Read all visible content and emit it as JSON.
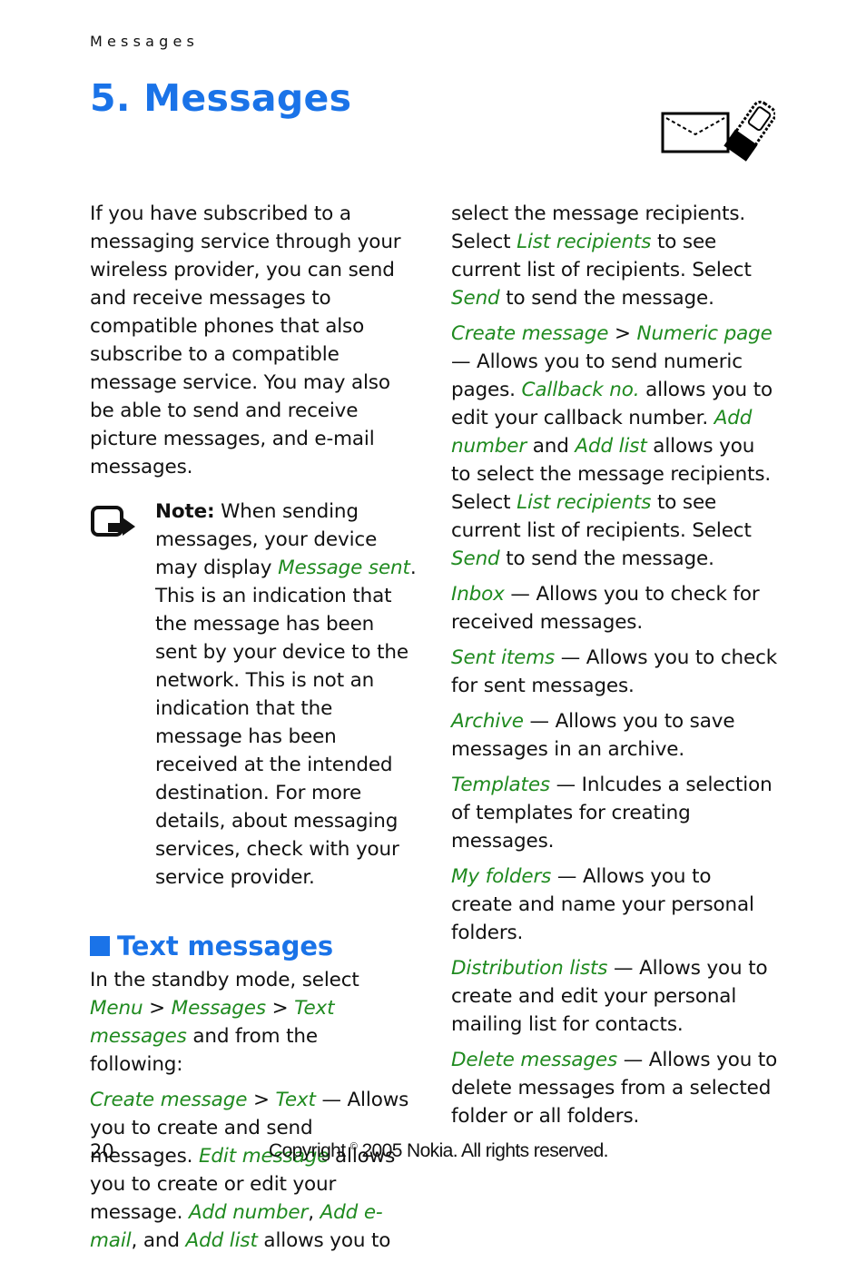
{
  "header": {
    "running_title": "Messages"
  },
  "chapter": {
    "title": "5. Messages",
    "icon": "envelope-phone-icon"
  },
  "intro": "If you have subscribed to a messaging service through your wireless provider, you can send and receive messages to compatible phones that also subscribe to a compatible message service. You may also be able to send and receive picture messages, and e-mail messages.",
  "note": {
    "label": "Note:",
    "text_before": " When sending messages, your device may display ",
    "highlight": "Message sent",
    "text_after": ". This is an indication that the message has been sent by your device to the network. This is not an indication that the message has been received at the intended destination. For more details, about messaging services, check with your service provider."
  },
  "section": {
    "title": "Text messages",
    "intro": {
      "t1": "In the standby mode, select ",
      "menu": "Menu",
      "sep1": " > ",
      "messages": "Messages",
      "sep2": " > ",
      "text_messages": "Text messages",
      "t2": " and from the following:"
    },
    "create_text": {
      "create": "Create message",
      "sep": " > ",
      "text": "Text",
      "t1": " — Allows you to create and send messages. ",
      "edit": "Edit message",
      "t2": " allows you to create or edit your message. ",
      "add_number": "Add number",
      "comma": ", ",
      "add_email": "Add e-mail",
      "t3": ", and ",
      "add_list": "Add list",
      "t4": " allows you to select the message recipients. Select ",
      "list_recipients": "List recipients",
      "t5": " to see current list of recipients. Select ",
      "send": "Send",
      "t6": " to send the message."
    },
    "create_numeric": {
      "create": "Create message",
      "sep": " > ",
      "numeric": "Numeric page",
      "t1": " — Allows you to send numeric pages. ",
      "callback": "Callback no.",
      "t2": " allows you to edit your callback number. ",
      "add_number": "Add number",
      "t3": " and ",
      "add_list": "Add list",
      "t4": " allows you to select the message recipients. Select ",
      "list_recipients": "List recipients",
      "t5": " to see current list of recipients. Select ",
      "send": "Send",
      "t6": " to send the message."
    },
    "items": [
      {
        "term": "Inbox",
        "desc": " — Allows you to check for received messages."
      },
      {
        "term": "Sent items",
        "desc": " — Allows you to check for sent messages."
      },
      {
        "term": "Archive",
        "desc": " — Allows you to save messages in an archive."
      },
      {
        "term": "Templates",
        "desc": " — Inlcudes a selection of templates for creating messages."
      },
      {
        "term": "My folders",
        "desc": " — Allows you to create and name your personal folders."
      },
      {
        "term": "Distribution lists",
        "desc": " — Allows you to create and edit your personal mailing list for contacts."
      },
      {
        "term": "Delete messages",
        "desc": " — Allows you to delete messages from a selected folder or all folders."
      }
    ]
  },
  "footer": {
    "page_number": "20",
    "copyright_pre": "Copyright ",
    "copyright_symbol": "©",
    "copyright_post": " 2005 Nokia. All rights reserved."
  },
  "colors": {
    "heading_blue": "#1a73e8",
    "term_green": "#1f8a1f"
  }
}
